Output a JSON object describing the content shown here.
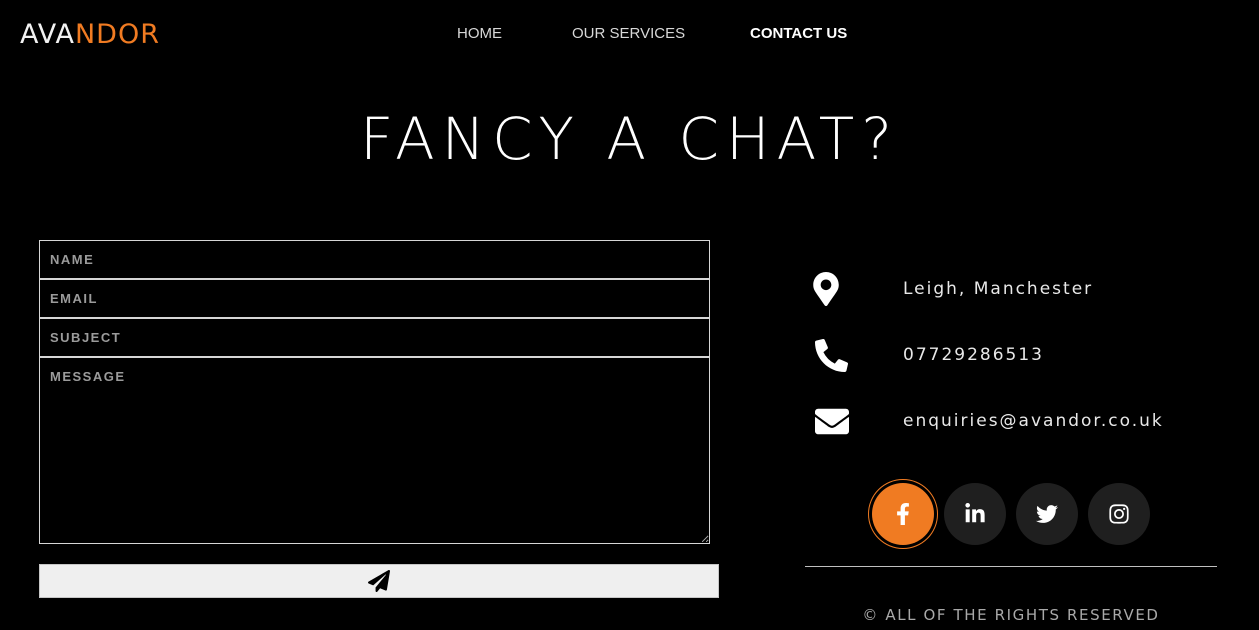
{
  "brand": {
    "logo_part1": "AVA",
    "logo_part2": "NDOR",
    "accent_color": "#f07b22"
  },
  "nav": {
    "items": [
      {
        "label": "HOME"
      },
      {
        "label": "OUR SERVICES"
      },
      {
        "label": "CONTACT US"
      }
    ],
    "active": "CONTACT US"
  },
  "hero": {
    "title": "FANCY A CHAT?"
  },
  "form": {
    "name_placeholder": "NAME",
    "email_placeholder": "EMAIL",
    "subject_placeholder": "SUBJECT",
    "message_placeholder": "MESSAGE",
    "submit_icon": "paper-plane-icon"
  },
  "contact": {
    "location": {
      "icon": "map-pin-icon",
      "text": "Leigh, Manchester"
    },
    "phone": {
      "icon": "phone-icon",
      "text": "07729286513"
    },
    "email": {
      "icon": "envelope-icon",
      "text": "enquiries@avandor.co.uk"
    }
  },
  "socials": [
    {
      "icon": "facebook-icon",
      "color": "#f07b22"
    },
    {
      "icon": "linkedin-icon",
      "color": "#1f1f1f"
    },
    {
      "icon": "twitter-icon",
      "color": "#1f1f1f"
    },
    {
      "icon": "instagram-icon",
      "color": "#1f1f1f"
    }
  ],
  "footer": {
    "copyright": "© ALL OF THE RIGHTS RESERVED"
  }
}
